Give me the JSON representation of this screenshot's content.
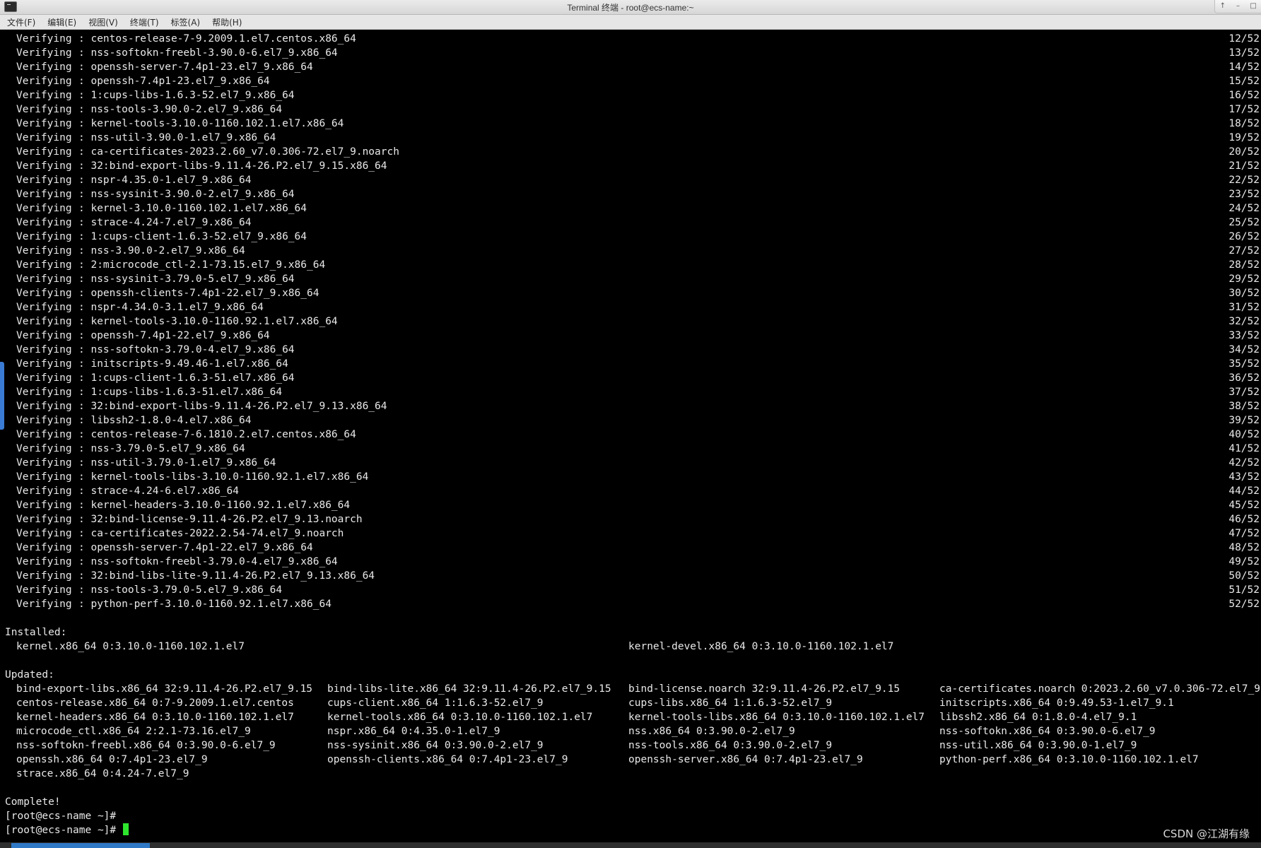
{
  "window": {
    "title": "Terminal 终端 - root@ecs-name:~",
    "controls": [
      "up-icon",
      "minimize-icon",
      "maximize-icon"
    ]
  },
  "menu": [
    "文件(F)",
    "编辑(E)",
    "视图(V)",
    "终端(T)",
    "标签(A)",
    "帮助(H)"
  ],
  "verify_label": "Verifying",
  "verify_lines": [
    {
      "pkg": ": centos-release-7-9.2009.1.el7.centos.x86_64",
      "count": "12/52"
    },
    {
      "pkg": ": nss-softokn-freebl-3.90.0-6.el7_9.x86_64",
      "count": "13/52"
    },
    {
      "pkg": ": openssh-server-7.4p1-23.el7_9.x86_64",
      "count": "14/52"
    },
    {
      "pkg": ": openssh-7.4p1-23.el7_9.x86_64",
      "count": "15/52"
    },
    {
      "pkg": ": 1:cups-libs-1.6.3-52.el7_9.x86_64",
      "count": "16/52"
    },
    {
      "pkg": ": nss-tools-3.90.0-2.el7_9.x86_64",
      "count": "17/52"
    },
    {
      "pkg": ": kernel-tools-3.10.0-1160.102.1.el7.x86_64",
      "count": "18/52"
    },
    {
      "pkg": ": nss-util-3.90.0-1.el7_9.x86_64",
      "count": "19/52"
    },
    {
      "pkg": ": ca-certificates-2023.2.60_v7.0.306-72.el7_9.noarch",
      "count": "20/52"
    },
    {
      "pkg": ": 32:bind-export-libs-9.11.4-26.P2.el7_9.15.x86_64",
      "count": "21/52"
    },
    {
      "pkg": ": nspr-4.35.0-1.el7_9.x86_64",
      "count": "22/52"
    },
    {
      "pkg": ": nss-sysinit-3.90.0-2.el7_9.x86_64",
      "count": "23/52"
    },
    {
      "pkg": ": kernel-3.10.0-1160.102.1.el7.x86_64",
      "count": "24/52"
    },
    {
      "pkg": ": strace-4.24-7.el7_9.x86_64",
      "count": "25/52"
    },
    {
      "pkg": ": 1:cups-client-1.6.3-52.el7_9.x86_64",
      "count": "26/52"
    },
    {
      "pkg": ": nss-3.90.0-2.el7_9.x86_64",
      "count": "27/52"
    },
    {
      "pkg": ": 2:microcode_ctl-2.1-73.15.el7_9.x86_64",
      "count": "28/52"
    },
    {
      "pkg": ": nss-sysinit-3.79.0-5.el7_9.x86_64",
      "count": "29/52"
    },
    {
      "pkg": ": openssh-clients-7.4p1-22.el7_9.x86_64",
      "count": "30/52"
    },
    {
      "pkg": ": nspr-4.34.0-3.1.el7_9.x86_64",
      "count": "31/52"
    },
    {
      "pkg": ": kernel-tools-3.10.0-1160.92.1.el7.x86_64",
      "count": "32/52"
    },
    {
      "pkg": ": openssh-7.4p1-22.el7_9.x86_64",
      "count": "33/52"
    },
    {
      "pkg": ": nss-softokn-3.79.0-4.el7_9.x86_64",
      "count": "34/52"
    },
    {
      "pkg": ": initscripts-9.49.46-1.el7.x86_64",
      "count": "35/52"
    },
    {
      "pkg": ": 1:cups-client-1.6.3-51.el7.x86_64",
      "count": "36/52"
    },
    {
      "pkg": ": 1:cups-libs-1.6.3-51.el7.x86_64",
      "count": "37/52"
    },
    {
      "pkg": ": 32:bind-export-libs-9.11.4-26.P2.el7_9.13.x86_64",
      "count": "38/52"
    },
    {
      "pkg": ": libssh2-1.8.0-4.el7.x86_64",
      "count": "39/52"
    },
    {
      "pkg": ": centos-release-7-6.1810.2.el7.centos.x86_64",
      "count": "40/52"
    },
    {
      "pkg": ": nss-3.79.0-5.el7_9.x86_64",
      "count": "41/52"
    },
    {
      "pkg": ": nss-util-3.79.0-1.el7_9.x86_64",
      "count": "42/52"
    },
    {
      "pkg": ": kernel-tools-libs-3.10.0-1160.92.1.el7.x86_64",
      "count": "43/52"
    },
    {
      "pkg": ": strace-4.24-6.el7.x86_64",
      "count": "44/52"
    },
    {
      "pkg": ": kernel-headers-3.10.0-1160.92.1.el7.x86_64",
      "count": "45/52"
    },
    {
      "pkg": ": 32:bind-license-9.11.4-26.P2.el7_9.13.noarch",
      "count": "46/52"
    },
    {
      "pkg": ": ca-certificates-2022.2.54-74.el7_9.noarch",
      "count": "47/52"
    },
    {
      "pkg": ": openssh-server-7.4p1-22.el7_9.x86_64",
      "count": "48/52"
    },
    {
      "pkg": ": nss-softokn-freebl-3.79.0-4.el7_9.x86_64",
      "count": "49/52"
    },
    {
      "pkg": ": 32:bind-libs-lite-9.11.4-26.P2.el7_9.13.x86_64",
      "count": "50/52"
    },
    {
      "pkg": ": nss-tools-3.79.0-5.el7_9.x86_64",
      "count": "51/52"
    },
    {
      "pkg": ": python-perf-3.10.0-1160.92.1.el7.x86_64",
      "count": "52/52"
    }
  ],
  "installed": {
    "header": "Installed:",
    "items": [
      "kernel.x86_64 0:3.10.0-1160.102.1.el7",
      "kernel-devel.x86_64 0:3.10.0-1160.102.1.el7"
    ]
  },
  "updated": {
    "header": "Updated:",
    "rows": [
      [
        "bind-export-libs.x86_64 32:9.11.4-26.P2.el7_9.15",
        "bind-libs-lite.x86_64 32:9.11.4-26.P2.el7_9.15",
        "bind-license.noarch 32:9.11.4-26.P2.el7_9.15",
        "ca-certificates.noarch 0:2023.2.60_v7.0.306-72.el7_9"
      ],
      [
        "centos-release.x86_64 0:7-9.2009.1.el7.centos",
        "cups-client.x86_64 1:1.6.3-52.el7_9",
        "cups-libs.x86_64 1:1.6.3-52.el7_9",
        "initscripts.x86_64 0:9.49.53-1.el7_9.1"
      ],
      [
        "kernel-headers.x86_64 0:3.10.0-1160.102.1.el7",
        "kernel-tools.x86_64 0:3.10.0-1160.102.1.el7",
        "kernel-tools-libs.x86_64 0:3.10.0-1160.102.1.el7",
        "libssh2.x86_64 0:1.8.0-4.el7_9.1"
      ],
      [
        "microcode_ctl.x86_64 2:2.1-73.16.el7_9",
        "nspr.x86_64 0:4.35.0-1.el7_9",
        "nss.x86_64 0:3.90.0-2.el7_9",
        "nss-softokn.x86_64 0:3.90.0-6.el7_9"
      ],
      [
        "nss-softokn-freebl.x86_64 0:3.90.0-6.el7_9",
        "nss-sysinit.x86_64 0:3.90.0-2.el7_9",
        "nss-tools.x86_64 0:3.90.0-2.el7_9",
        "nss-util.x86_64 0:3.90.0-1.el7_9"
      ],
      [
        "openssh.x86_64 0:7.4p1-23.el7_9",
        "openssh-clients.x86_64 0:7.4p1-23.el7_9",
        "openssh-server.x86_64 0:7.4p1-23.el7_9",
        "python-perf.x86_64 0:3.10.0-1160.102.1.el7"
      ],
      [
        "strace.x86_64 0:4.24-7.el7_9",
        "",
        "",
        ""
      ]
    ]
  },
  "complete": "Complete!",
  "prompts": [
    "[root@ecs-name ~]#",
    "[root@ecs-name ~]# "
  ],
  "watermark": "CSDN @江湖有缘",
  "colors": {
    "background": "#000000",
    "text": "#e9e9e9",
    "cursor": "#2ee52e",
    "accent": "#2f79c6"
  }
}
